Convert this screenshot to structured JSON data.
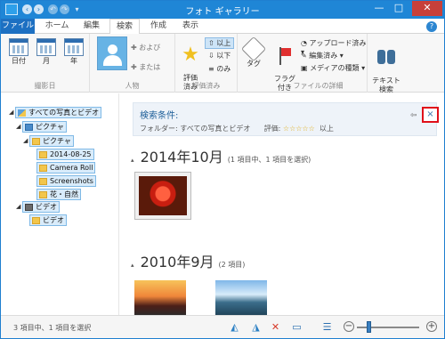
{
  "window": {
    "title": "フォト ギャラリー",
    "quick_access": [
      "back-icon",
      "forward-icon",
      "undo-icon",
      "redo-icon",
      "customize-icon"
    ],
    "controls": {
      "minimize": "—",
      "maximize": "□",
      "close": "✕"
    }
  },
  "tabs": [
    {
      "label": "ファイル",
      "active": false
    },
    {
      "label": "ホーム",
      "active": false
    },
    {
      "label": "編集",
      "active": false
    },
    {
      "label": "検索",
      "active": true
    },
    {
      "label": "作成",
      "active": false
    },
    {
      "label": "表示",
      "active": false
    }
  ],
  "help_label": "?",
  "ribbon": {
    "date_group": {
      "label": "撮影日",
      "buttons": [
        {
          "label": "日付"
        },
        {
          "label": "月"
        },
        {
          "label": "年"
        }
      ]
    },
    "people_group": {
      "label": "人物",
      "and_label": "および",
      "or_label": "または"
    },
    "rating_group": {
      "label": "評価済み",
      "rated_label": "評価\n済み",
      "above_label": "以上",
      "below_label": "以下",
      "only_label": "のみ"
    },
    "tag_label": "タグ",
    "details_group": {
      "label": "ファイルの詳細",
      "flag_label": "フラグ\n付き",
      "uploaded_label": "アップロード済み",
      "edited_label": "編集済み",
      "media_label": "メディアの種類"
    },
    "text_search_label": "テキスト\n検索"
  },
  "tree": [
    {
      "label": "すべての写真とビデオ",
      "icon": "all-media-icon"
    },
    {
      "label": "ピクチャ",
      "icon": "pictures-library-icon"
    },
    {
      "label": "ピクチャ",
      "icon": "folder-icon"
    },
    {
      "label": "2014-08-25",
      "icon": "folder-icon"
    },
    {
      "label": "Camera Roll",
      "icon": "folder-icon"
    },
    {
      "label": "Screenshots",
      "icon": "folder-icon"
    },
    {
      "label": "花・自然",
      "icon": "folder-icon"
    },
    {
      "label": "ビデオ",
      "icon": "videos-library-icon"
    },
    {
      "label": "ビデオ",
      "icon": "folder-icon"
    }
  ],
  "search": {
    "title": "検索条件:",
    "folder_label": "フォルダー:",
    "folder_value": "すべての写真とビデオ",
    "rating_label": "評価:",
    "rating_stars": "☆☆☆☆☆",
    "rating_suffix": "以上",
    "back_glyph": "⇦",
    "close_glyph": "×"
  },
  "groups": [
    {
      "month": "2014年10月",
      "count": "(1 項目中、1 項目を選択)",
      "thumbnails": [
        "rose"
      ]
    },
    {
      "month": "2010年9月",
      "count": "(2 項目)",
      "thumbnails": [
        "sunset",
        "lake"
      ]
    }
  ],
  "status": {
    "text": "3 項目中、1 項目を選択",
    "zoom_percent": 15
  },
  "colors": {
    "title_bar": "#1f86d6",
    "file_tab": "#1d70c2",
    "selection_fill": "#d9ecfb",
    "close_highlight": "#e0101a"
  }
}
